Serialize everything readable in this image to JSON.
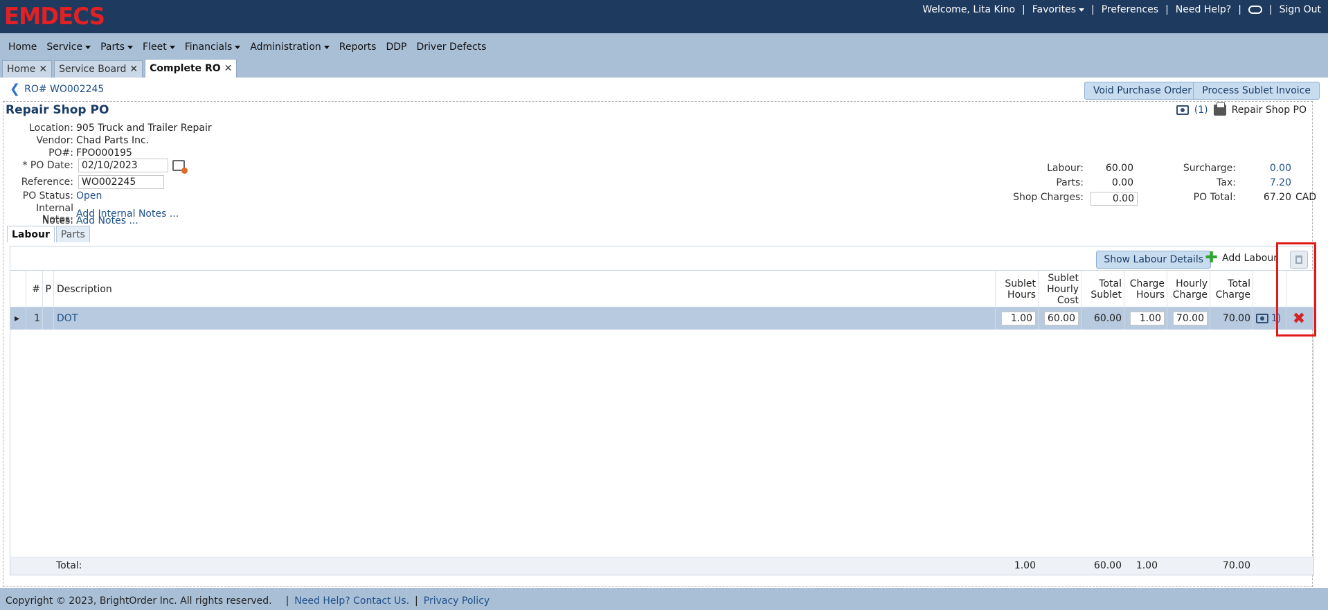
{
  "header": {
    "logo": "EMDECS",
    "welcome": "Welcome, Lita Kino",
    "favorites": "Favorites",
    "preferences": "Preferences",
    "need_help": "Need Help?",
    "sign_out": "Sign Out"
  },
  "menu": [
    "Home",
    "Service",
    "Parts",
    "Fleet",
    "Financials",
    "Administration",
    "Reports",
    "DDP",
    "Driver Defects"
  ],
  "tabs": [
    "Home",
    "Service Board",
    "Complete RO"
  ],
  "ro_link": "RO# WO002245",
  "buttons": {
    "void_po": "Void Purchase Order",
    "process_sublet": "Process Sublet Invoice"
  },
  "po": {
    "title": "Repair Shop PO",
    "attach_count": "(1)",
    "print_label": "Repair Shop PO",
    "location_label": "Location:",
    "location": "905 Truck and Trailer Repair",
    "vendor_label": "Vendor:",
    "vendor": "Chad Parts Inc.",
    "po_label": "PO#:",
    "po_number": "FPO000195",
    "date_label": "* PO Date:",
    "date": "02/10/2023",
    "reference_label": "Reference:",
    "reference": "WO002245",
    "status_label": "PO Status:",
    "status": "Open",
    "internal_notes_label": "Internal Notes:",
    "internal_notes": "Add Internal Notes ...",
    "notes_label": "Notes:",
    "notes": "Add Notes ..."
  },
  "totals": {
    "labour_label": "Labour:",
    "labour": "60.00",
    "parts_label": "Parts:",
    "parts": "0.00",
    "shop_label": "Shop Charges:",
    "shop": "0.00",
    "surcharge_label": "Surcharge:",
    "surcharge": "0.00",
    "tax_label": "Tax:",
    "tax": "7.20",
    "po_total_label": "PO Total:",
    "po_total": "67.20",
    "currency": "CAD"
  },
  "subtabs": [
    "Labour",
    "Parts"
  ],
  "grid": {
    "show_details": "Show Labour Details",
    "add_labour": "Add Labour",
    "columns": {
      "num": "#",
      "p": "P",
      "description": "Description",
      "sublet_hours": "Sublet Hours",
      "sublet_hourly_cost": "Sublet Hourly Cost",
      "total_sublet": "Total Sublet",
      "charge_hours": "Charge Hours",
      "hourly_charge": "Hourly Charge",
      "total_charge": "Total Charge"
    },
    "row": {
      "num": "1",
      "description": "DOT",
      "sublet_hours": "1.00",
      "sublet_hourly_cost": "60.00",
      "total_sublet": "60.00",
      "charge_hours": "1.00",
      "hourly_charge": "70.00",
      "total_charge": "70.00",
      "attach": "1)"
    },
    "footer": {
      "label": "Total:",
      "sublet_hours": "1.00",
      "total_sublet": "60.00",
      "charge_hours": "1.00",
      "total_charge": "70.00"
    }
  },
  "footer": {
    "copyright": "Copyright © 2023, BrightOrder Inc. All rights reserved.",
    "contact": "Need Help? Contact Us.",
    "privacy": "Privacy Policy"
  }
}
